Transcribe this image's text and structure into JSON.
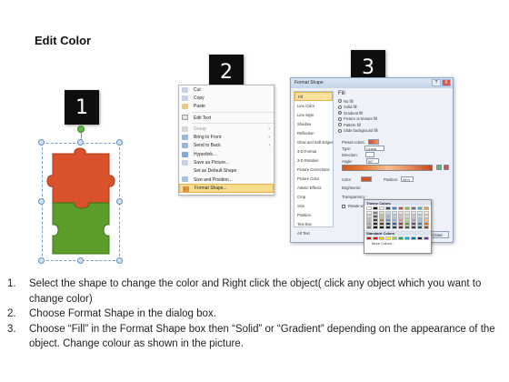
{
  "title": "Edit Color",
  "step_boxes": [
    {
      "label": "1"
    },
    {
      "label": "2"
    },
    {
      "label": "3"
    }
  ],
  "puzzle": {
    "top_piece_color": "#d9522b",
    "bottom_piece_color": "#5b9e2b"
  },
  "context_menu": {
    "items": [
      {
        "label": "Cut",
        "icon": "scissors-icon",
        "enabled": true
      },
      {
        "label": "Copy",
        "icon": "copy-icon",
        "enabled": true
      },
      {
        "label": "Paste",
        "icon": "paste-icon",
        "enabled": true
      },
      {
        "label": "Edit Text",
        "icon": "edit-text-icon",
        "enabled": true
      },
      {
        "label": "Group",
        "icon": "group-icon",
        "enabled": false,
        "submenu": true
      },
      {
        "label": "Bring to Front",
        "icon": "bring-front-icon",
        "enabled": true,
        "submenu": true
      },
      {
        "label": "Send to Back",
        "icon": "send-back-icon",
        "enabled": true,
        "submenu": true
      },
      {
        "label": "Hyperlink...",
        "icon": "hyperlink-icon",
        "enabled": true
      },
      {
        "label": "Save as Picture...",
        "icon": "save-picture-icon",
        "enabled": true
      },
      {
        "label": "Set as Default Shape",
        "icon": "",
        "enabled": true
      },
      {
        "label": "Size and Position...",
        "icon": "size-icon",
        "enabled": true
      },
      {
        "label": "Format Shape...",
        "icon": "format-shape-icon",
        "enabled": true,
        "highlight": true
      }
    ]
  },
  "dialog": {
    "title": "Format Shape",
    "close_label": "X",
    "nav": [
      "Fill",
      "Line Color",
      "Line Style",
      "Shadow",
      "Reflection",
      "Glow and Soft Edges",
      "3-D Format",
      "3-D Rotation",
      "Picture Corrections",
      "Picture Color",
      "Artistic Effects",
      "Crop",
      "Size",
      "Position",
      "Text Box",
      "Alt Text"
    ],
    "active_nav": "Fill",
    "section_title": "Fill",
    "fill_options": [
      {
        "label": "No fill",
        "selected": false
      },
      {
        "label": "Solid fill",
        "selected": false
      },
      {
        "label": "Gradient fill",
        "selected": true
      },
      {
        "label": "Picture or texture fill",
        "selected": false
      },
      {
        "label": "Pattern fill",
        "selected": false
      },
      {
        "label": "Slide background fill",
        "selected": false
      }
    ],
    "preset_colors_label": "Preset colors:",
    "type_label": "Type:",
    "type_value": "Linear",
    "direction_label": "Direction:",
    "angle_label": "Angle:",
    "angle_value": "90°",
    "gradient_stops_label": "Gradient stops",
    "color_label": "Color",
    "position_label": "Position:",
    "position_value": "94%",
    "brightness_label": "Brightness:",
    "transparency_label": "Transparency:",
    "rotate_label": "Rotate w",
    "close_button": "Close"
  },
  "color_popup": {
    "theme_colors_label": "Theme Colors",
    "standard_colors_label": "Standard Colors",
    "more_colors_label": "More Colors...",
    "theme_rows": [
      [
        "#ffffff",
        "#000000",
        "#eeece1",
        "#1f497d",
        "#4f81bd",
        "#c0504d",
        "#9bbb59",
        "#8064a2",
        "#4bacc6",
        "#f79646"
      ],
      [
        "#f2f2f2",
        "#7f7f7f",
        "#ddd9c3",
        "#c6d9f0",
        "#dbe5f1",
        "#f2dcdb",
        "#ebf1dd",
        "#e5e0ec",
        "#dbeef3",
        "#fdeada"
      ],
      [
        "#d8d8d8",
        "#595959",
        "#c4bd97",
        "#8db3e2",
        "#b8cce4",
        "#e5b9b7",
        "#d7e3bc",
        "#ccc1d9",
        "#b7dde8",
        "#fbd5b5"
      ],
      [
        "#bfbfbf",
        "#3f3f3f",
        "#938953",
        "#548dd4",
        "#95b3d7",
        "#d99694",
        "#c3d69b",
        "#b2a2c7",
        "#92cddc",
        "#fac08f"
      ],
      [
        "#a5a5a5",
        "#262626",
        "#494429",
        "#17365d",
        "#366092",
        "#953734",
        "#76923c",
        "#5f497a",
        "#31859b",
        "#e36c09"
      ],
      [
        "#7f7f7f",
        "#0c0c0c",
        "#1d1b10",
        "#0f243e",
        "#244061",
        "#632423",
        "#4f6128",
        "#3f3151",
        "#205867",
        "#974806"
      ]
    ],
    "standard_row": [
      "#c00000",
      "#ff0000",
      "#ffc000",
      "#ffff00",
      "#92d050",
      "#00b050",
      "#00b0f0",
      "#0070c0",
      "#002060",
      "#7030a0"
    ]
  },
  "steps": [
    {
      "num": "1.",
      "text": "Select the shape to change the color and Right click the object( click any object which you want to change color)"
    },
    {
      "num": "2.",
      "text": "Choose Format Shape in the dialog box."
    },
    {
      "num": "3.",
      "text": "Choose “Fill” in the Format Shape box then “Solid” or “Gradient” depending on the appearance of the object. Change colour as shown in the picture."
    }
  ]
}
